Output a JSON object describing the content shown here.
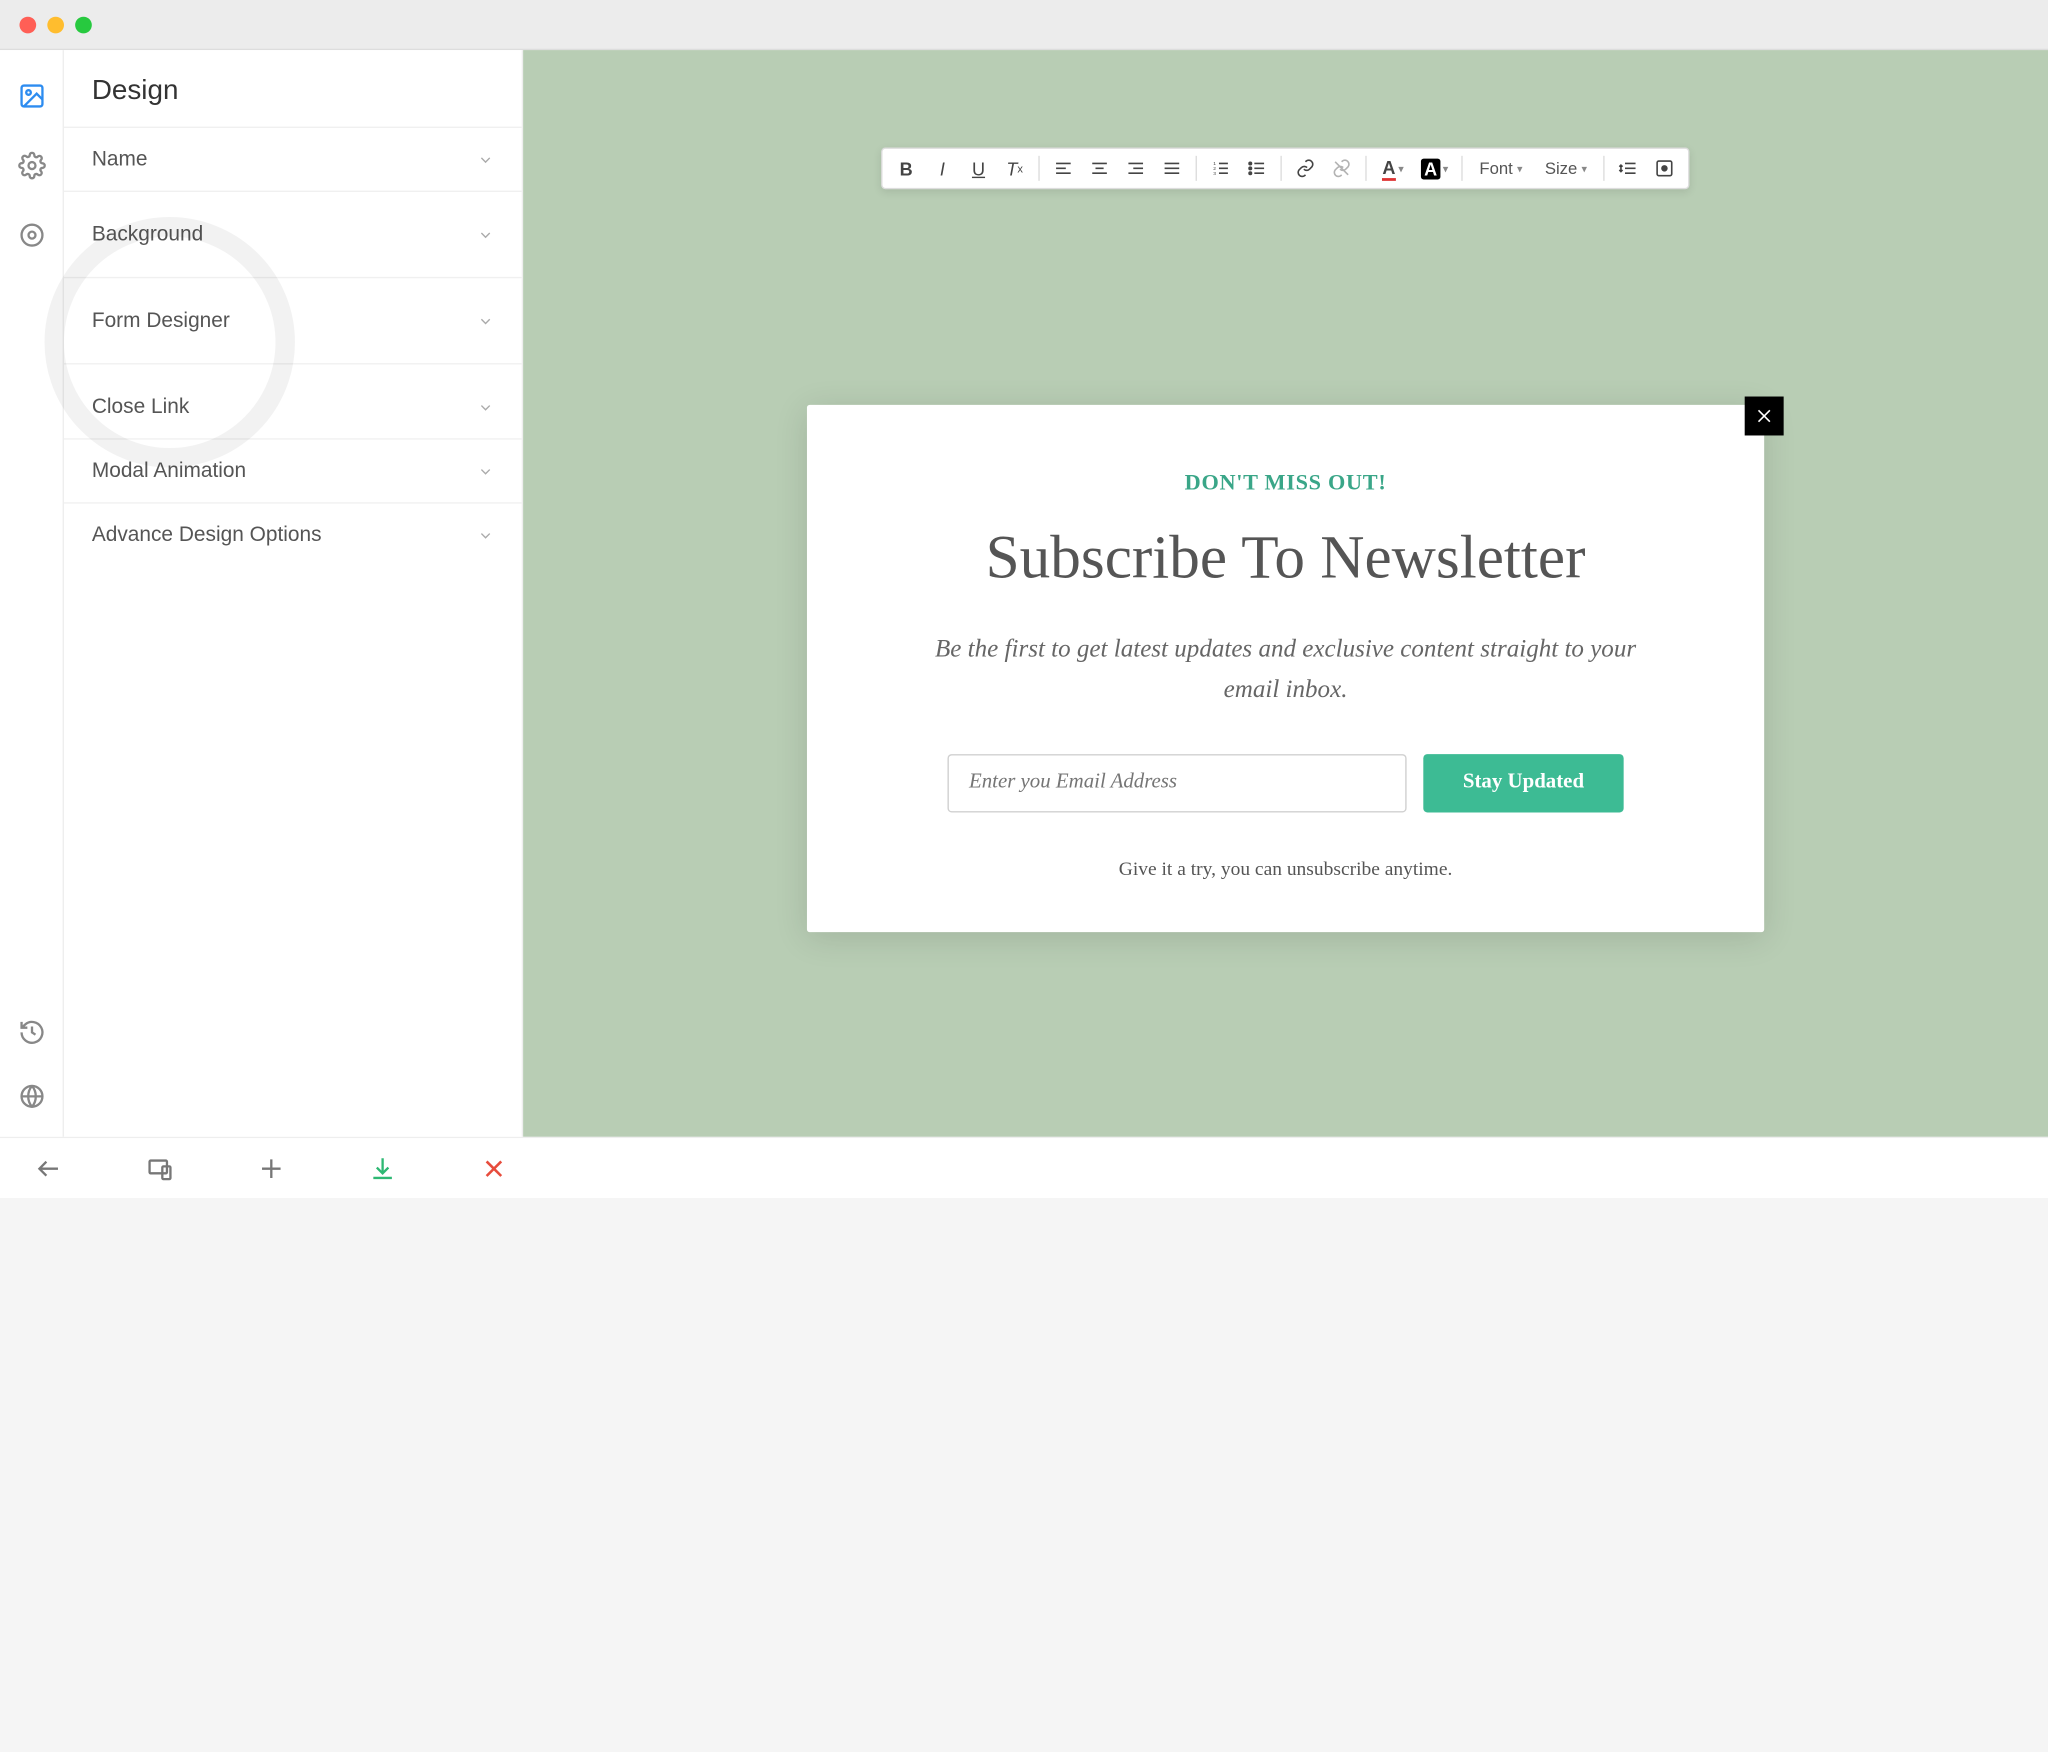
{
  "sidebar": {
    "title": "Design",
    "items": [
      {
        "label": "Name"
      },
      {
        "label": "Background"
      },
      {
        "label": "Form Designer"
      },
      {
        "label": "Close Link"
      },
      {
        "label": "Modal Animation"
      },
      {
        "label": "Advance Design Options"
      }
    ]
  },
  "rte": {
    "font_label": "Font",
    "size_label": "Size"
  },
  "modal": {
    "eyebrow": "DON'T MISS OUT!",
    "heading": "Subscribe To Newsletter",
    "sub": "Be the first to get latest updates and exclusive content straight to your email inbox.",
    "email_placeholder": "Enter you Email Address",
    "cta": "Stay Updated",
    "foot": "Give it a try, you can unsubscribe anytime."
  },
  "colors": {
    "canvas_bg": "#b8cdb4",
    "accent": "#3dbb94",
    "eyebrow": "#3aa688"
  }
}
